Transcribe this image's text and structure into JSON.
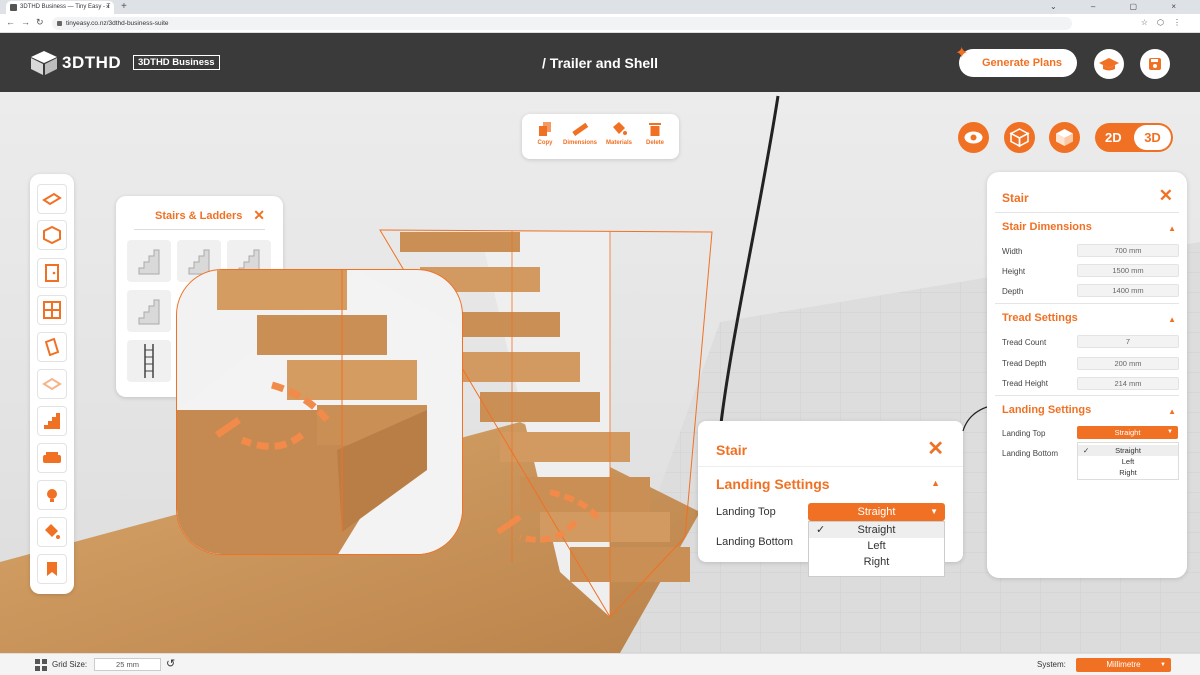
{
  "browser": {
    "tab_title": "3DTHD Business — Tiny Easy - T",
    "tab_close": "×",
    "new_tab": "+",
    "window_controls": "⌄ – ▢ ×",
    "url": "tinyeasy.co.nz/3dthd-business-suite"
  },
  "header": {
    "logo_text": "3DTHD",
    "badge": "3DTHD Business",
    "page_title": "/ Trailer and Shell",
    "generate_label": "Generate Plans"
  },
  "toolbar": {
    "copy": "Copy",
    "dimensions": "Dimensions",
    "materials": "Materials",
    "delete": "Delete"
  },
  "view_toggle": {
    "label_2d": "2D",
    "label_3d": "3D",
    "active": "3D"
  },
  "stairs_panel": {
    "title": "Stairs & Ladders",
    "close": "✕"
  },
  "stair_dialog": {
    "title": "Stair",
    "close": "✕",
    "section": "Landing Settings",
    "landing_top_label": "Landing Top",
    "landing_bottom_label": "Landing Bottom",
    "landing_top_value": "Straight",
    "options": [
      "Straight",
      "Left",
      "Right"
    ],
    "check": "✓"
  },
  "right_panel": {
    "title": "Stair",
    "close": "✕",
    "dimensions_title": "Stair Dimensions",
    "width_label": "Width",
    "width_value": "700 mm",
    "height_label": "Height",
    "height_value": "1500 mm",
    "depth_label": "Depth",
    "depth_value": "1400 mm",
    "tread_title": "Tread Settings",
    "tread_count_label": "Tread Count",
    "tread_count_value": "7",
    "tread_depth_label": "Tread Depth",
    "tread_depth_value": "200 mm",
    "tread_height_label": "Tread Height",
    "tread_height_value": "214 mm",
    "landing_title": "Landing Settings",
    "landing_top_label": "Landing Top",
    "landing_bottom_label": "Landing Bottom",
    "landing_top_value": "Straight",
    "options": [
      "Straight",
      "Left",
      "Right"
    ],
    "check": "✓"
  },
  "bottom_bar": {
    "grid_label": "Grid Size:",
    "grid_value": "25 mm",
    "system_label": "System:",
    "system_value": "Millimetre"
  },
  "colors": {
    "accent": "#f07124",
    "header_bg": "#3a3a3a"
  },
  "icons": [
    "copy-icon",
    "ruler-icon",
    "paint-bucket-icon",
    "trash-icon",
    "eye-icon",
    "cube-view-icon",
    "box-view-icon",
    "graduation-cap-icon",
    "save-icon"
  ]
}
